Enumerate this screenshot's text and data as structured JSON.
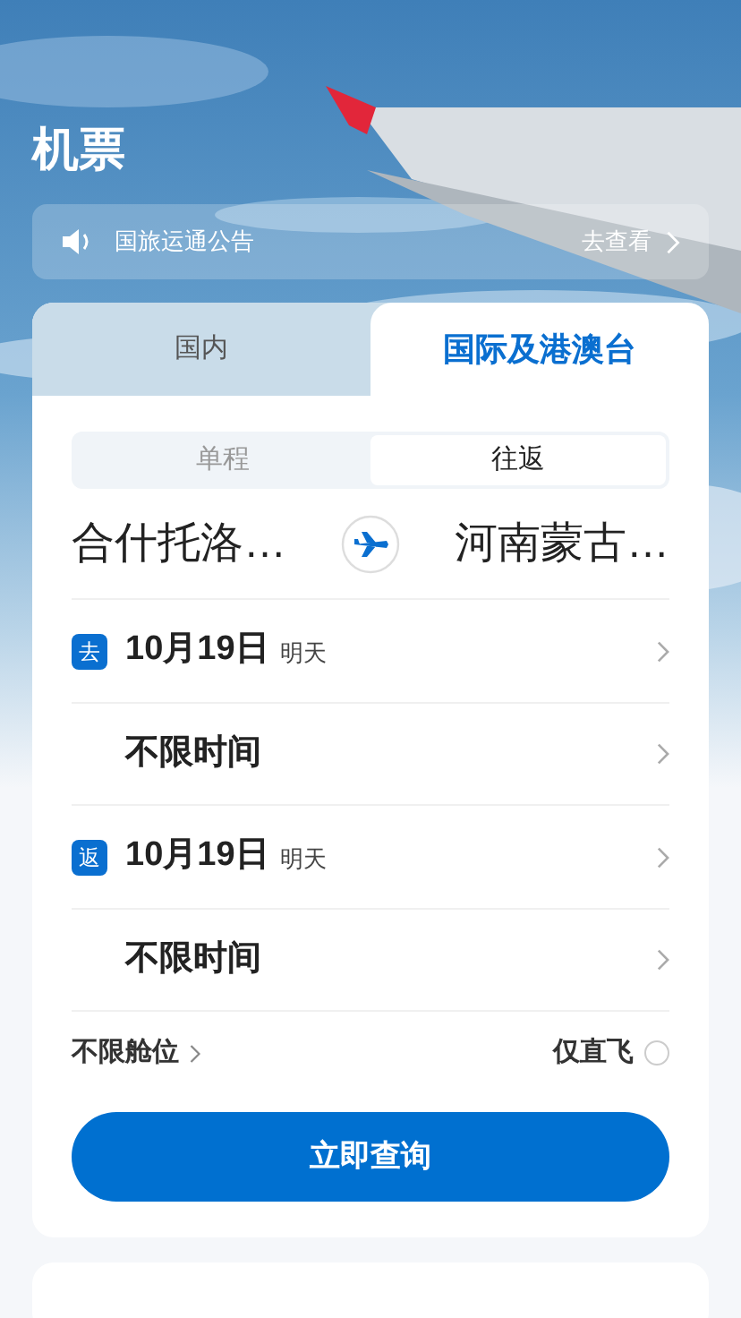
{
  "header": {
    "title": "机票"
  },
  "notice": {
    "text": "国旅运通公告",
    "link": "去查看"
  },
  "tabs": [
    {
      "label": "国内",
      "selected": false
    },
    {
      "label": "国际及港澳台",
      "selected": true
    }
  ],
  "trip_types": [
    {
      "label": "单程",
      "selected": false
    },
    {
      "label": "往返",
      "selected": true
    }
  ],
  "route": {
    "from": "合什托洛…",
    "to": "河南蒙古…"
  },
  "legs": [
    {
      "badge": "去",
      "date": "10月19日",
      "day": "明天",
      "time": "不限时间"
    },
    {
      "badge": "返",
      "date": "10月19日",
      "day": "明天",
      "time": "不限时间"
    }
  ],
  "cabin": "不限舱位",
  "direct_only": {
    "label": "仅直飞",
    "checked": false
  },
  "search_button": "立即查询"
}
